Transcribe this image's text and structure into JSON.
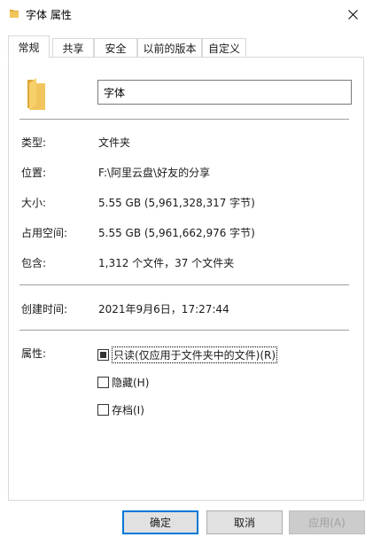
{
  "window": {
    "title": "字体 属性",
    "folder_icon": "folder-icon",
    "close_icon": "close-icon"
  },
  "tabs": [
    "常规",
    "共享",
    "安全",
    "以前的版本",
    "自定义"
  ],
  "active_tab": "常规",
  "general": {
    "name_value": "字体",
    "type_label": "类型:",
    "type_value": "文件夹",
    "location_label": "位置:",
    "location_value": "F:\\阿里云盘\\好友的分享",
    "size_label": "大小:",
    "size_value": "5.55 GB (5,961,328,317 字节)",
    "disk_size_label": "占用空间:",
    "disk_size_value": "5.55 GB (5,961,662,976 字节)",
    "contains_label": "包含:",
    "contains_value": "1,312 个文件，37 个文件夹",
    "created_label": "创建时间:",
    "created_value": "2021年9月6日，17:27:44",
    "attributes_label": "属性:",
    "attributes": [
      {
        "label": "只读(仅应用于文件夹中的文件)(R)",
        "state": "indeterminate"
      },
      {
        "label": "隐藏(H)",
        "state": "unchecked"
      },
      {
        "label": "存档(I)",
        "state": "unchecked"
      }
    ]
  },
  "buttons": {
    "ok": "确定",
    "cancel": "取消",
    "apply": "应用(A)"
  },
  "colors": {
    "folder": "#f2c55c",
    "folder_dark": "#dca937",
    "accent": "#0078d7"
  }
}
